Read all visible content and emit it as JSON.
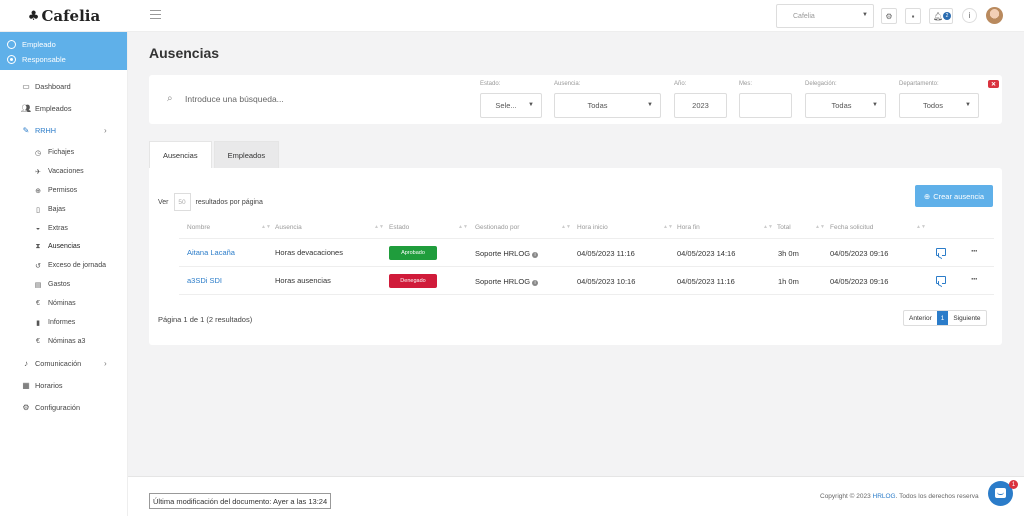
{
  "brand": {
    "name": "Cafelia",
    "mark": "♣"
  },
  "header": {
    "company_select_value": "Cafelia",
    "notifications_count": "2",
    "icons": [
      "menu-icon",
      "gear-icon",
      "message-icon",
      "bell-icon",
      "info-icon"
    ]
  },
  "sidebar": {
    "roles": [
      {
        "label": "Empleado",
        "selected": false
      },
      {
        "label": "Responsable",
        "selected": true
      }
    ],
    "items": [
      {
        "label": "Dashboard",
        "icon": "monitor-icon"
      },
      {
        "label": "Empleados",
        "icon": "users-icon"
      },
      {
        "label": "RRHH",
        "icon": "edit-icon"
      },
      {
        "label": "Fichajes",
        "icon": "clock-icon"
      },
      {
        "label": "Vacaciones",
        "icon": "plane-icon"
      },
      {
        "label": "Permisos",
        "icon": "plus-circle-icon"
      },
      {
        "label": "Bajas",
        "icon": "medkit-icon"
      },
      {
        "label": "Extras",
        "icon": "car-icon"
      },
      {
        "label": "Ausencias",
        "icon": "hourglass-icon"
      },
      {
        "label": "Exceso de jornada",
        "icon": "history-icon"
      },
      {
        "label": "Gastos",
        "icon": "credit-card-icon"
      },
      {
        "label": "Nóminas",
        "icon": "euro-icon"
      },
      {
        "label": "Informes",
        "icon": "file-icon"
      },
      {
        "label": "Nóminas a3",
        "icon": "euro-icon"
      },
      {
        "label": "Comunicación",
        "icon": "bell-icon"
      },
      {
        "label": "Horarios",
        "icon": "calendar-icon"
      },
      {
        "label": "Configuración",
        "icon": "gear-icon"
      }
    ]
  },
  "page": {
    "title": "Ausencias"
  },
  "filters": {
    "search_placeholder": "Introduce una búsqueda...",
    "estado": {
      "label": "Estado:",
      "value": "Sele..."
    },
    "ausencia": {
      "label": "Ausencia:",
      "value": "Todas"
    },
    "anio": {
      "label": "Año:",
      "value": "2023"
    },
    "mes": {
      "label": "Mes:",
      "value": ""
    },
    "delegacion": {
      "label": "Delegación:",
      "value": "Todas"
    },
    "departamento": {
      "label": "Departamento:",
      "value": "Todos"
    }
  },
  "tabs": [
    {
      "label": "Ausencias",
      "active": true
    },
    {
      "label": "Empleados",
      "active": false
    }
  ],
  "table": {
    "perpage_prefix": "Ver",
    "perpage_value": "50",
    "perpage_suffix": "resultados por página",
    "create_label": "Crear ausencia",
    "columns": [
      "Nombre",
      "Ausencia",
      "Estado",
      "Gestionado por",
      "Hora inicio",
      "Hora fin",
      "Total",
      "Fecha solicitud"
    ],
    "rows": [
      {
        "nombre": "Aitana Lacaña",
        "ausencia": "Horas devacaciones",
        "estado": "Aprobado",
        "gestionado": "Soporte HRLOG",
        "inicio": "04/05/2023 11:16",
        "fin": "04/05/2023 14:16",
        "total": "3h 0m",
        "fecha": "04/05/2023 09:16"
      },
      {
        "nombre": "a3SDi SDI",
        "ausencia": "Horas ausencias",
        "estado": "Denegado",
        "gestionado": "Soporte HRLOG",
        "inicio": "04/05/2023 10:16",
        "fin": "04/05/2023 11:16",
        "total": "1h 0m",
        "fecha": "04/05/2023 09:16"
      }
    ],
    "pagination_info": "Página 1 de 1 (2 resultados)",
    "prev_label": "Anterior",
    "current_page": "1",
    "next_label": "Siguiente"
  },
  "footer": {
    "last_modified": "Última modificación del documento: Ayer a las 13:24",
    "copyright_prefix": "Copyright © 2023",
    "copyright_brand": "HRLOG",
    "copyright_suffix": ". Todos los derechos reserva",
    "chat_badge": "1"
  },
  "colors": {
    "accent": "#5fb0e9",
    "link": "#2b7cc9",
    "approved": "#1f9d3c",
    "denied": "#d01b3a"
  }
}
